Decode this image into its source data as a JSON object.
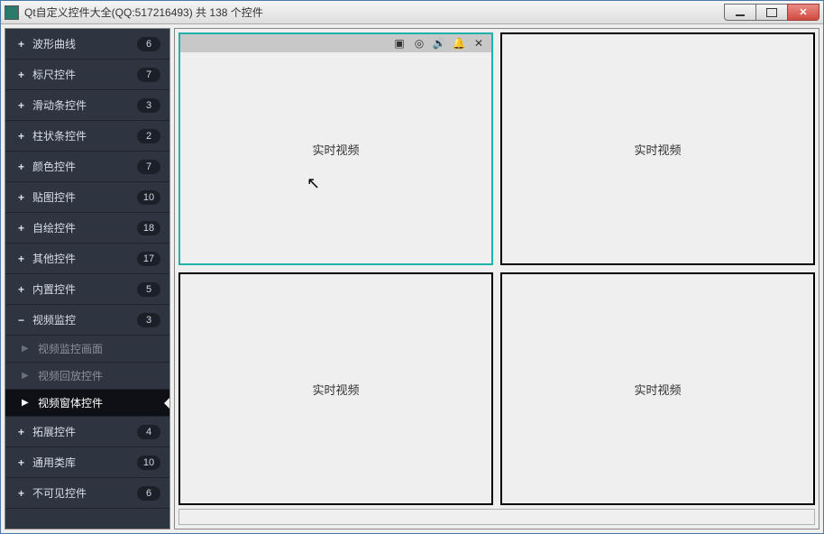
{
  "window": {
    "title": "Qt自定义控件大全(QQ:517216493) 共 138 个控件"
  },
  "sidebar": {
    "groups": [
      {
        "icon": "+",
        "label": "波形曲线",
        "count": 6
      },
      {
        "icon": "+",
        "label": "标尺控件",
        "count": 7
      },
      {
        "icon": "+",
        "label": "滑动条控件",
        "count": 3
      },
      {
        "icon": "+",
        "label": "柱状条控件",
        "count": 2
      },
      {
        "icon": "+",
        "label": "颜色控件",
        "count": 7
      },
      {
        "icon": "+",
        "label": "贴图控件",
        "count": 10
      },
      {
        "icon": "+",
        "label": "自绘控件",
        "count": 18
      },
      {
        "icon": "+",
        "label": "其他控件",
        "count": 17
      },
      {
        "icon": "+",
        "label": "内置控件",
        "count": 5
      },
      {
        "icon": "−",
        "label": "视频监控",
        "count": 3,
        "children": [
          {
            "label": "视频监控画面",
            "active": false
          },
          {
            "label": "视频回放控件",
            "active": false
          },
          {
            "label": "视频窗体控件",
            "active": true
          }
        ]
      },
      {
        "icon": "+",
        "label": "拓展控件",
        "count": 4
      },
      {
        "icon": "+",
        "label": "通用类库",
        "count": 10
      },
      {
        "icon": "+",
        "label": "不可见控件",
        "count": 6
      }
    ]
  },
  "video": {
    "panels": [
      {
        "label": "实时视频",
        "selected": true,
        "toolbar": true
      },
      {
        "label": "实时视频",
        "selected": false,
        "toolbar": false
      },
      {
        "label": "实时视频",
        "selected": false,
        "toolbar": false
      },
      {
        "label": "实时视频",
        "selected": false,
        "toolbar": false
      }
    ],
    "toolbar_icons": {
      "record": "record-icon",
      "snapshot": "snapshot-icon",
      "audio": "audio-icon",
      "alarm": "alarm-icon",
      "close": "close-icon"
    }
  }
}
